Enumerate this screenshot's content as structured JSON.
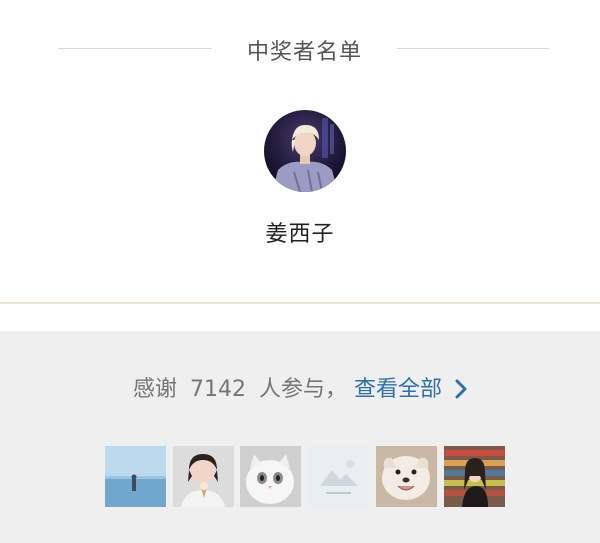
{
  "winners_section": {
    "title": "中奖者名单",
    "winner": {
      "name": "姜西子",
      "avatar_icon": "winner-avatar-photo"
    }
  },
  "participants": {
    "thanks_prefix": "感谢",
    "count": "7142",
    "thanks_suffix": "人参与，",
    "view_all_label": "查看全部",
    "view_all_icon": "chevron-right-icon",
    "avatars": [
      {
        "icon": "sea-horizon-photo"
      },
      {
        "icon": "girl-with-ice-cream-photo"
      },
      {
        "icon": "white-cat-photo"
      },
      {
        "icon": "mountain-placeholder-photo"
      },
      {
        "icon": "smiling-white-dog-photo"
      },
      {
        "icon": "girl-in-store-photo"
      }
    ]
  },
  "colors": {
    "link_blue": "#2e6fb0",
    "muted_text": "#757575",
    "section_bg": "#efefef",
    "divider_gold": "#ece6d2"
  }
}
